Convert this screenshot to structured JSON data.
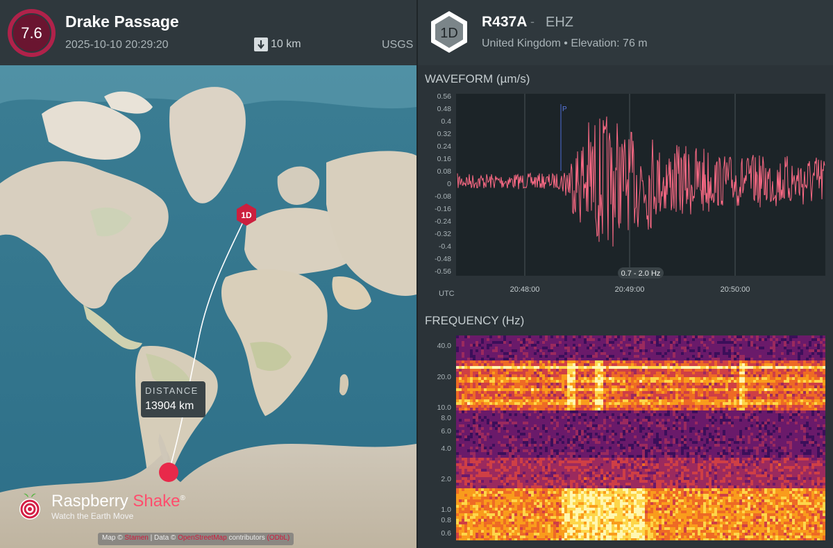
{
  "event": {
    "magnitude": "7.6",
    "title": "Drake Passage",
    "datetime": "2025-10-10 20:29:20",
    "depth": "10 km",
    "source": "USGS",
    "magnitude_color": "#b0224a"
  },
  "map": {
    "station_marker": "1D",
    "distance_label": "DISTANCE",
    "distance_value": "13904 km",
    "epicenter_color": "#e8294a",
    "logo_name_1": "Raspberry",
    "logo_name_2": "Shake",
    "logo_mark": "®",
    "logo_tagline": "Watch the Earth Move",
    "attribution_prefix": "Map ©",
    "attribution_link1": "Stamen",
    "attribution_middle": "| Data ©",
    "attribution_link2": "OpenStreetMap",
    "attribution_suffix": "contributors",
    "attribution_link3": "(ODbL)"
  },
  "station": {
    "badge": "1D",
    "name": "R437A",
    "separator": "-",
    "channel": "EHZ",
    "location": "United Kingdom • Elevation: 76 m"
  },
  "waveform": {
    "title": "WAVEFORM  (µm/s)",
    "y_ticks": [
      "0.56",
      "0.48",
      "0.4",
      "0.32",
      "0.24",
      "0.16",
      "0.08",
      "0",
      "-0.08",
      "-0.16",
      "-0.24",
      "-0.32",
      "-0.4",
      "-0.48",
      "-0.56"
    ],
    "x_ticks": [
      "20:48:00",
      "20:49:00",
      "20:50:00"
    ],
    "x_axis_label": "UTC",
    "phase_label": "P",
    "filter_label": "0.7 - 2.0 Hz",
    "trace_color": "#ff6b86"
  },
  "frequency": {
    "title": "FREQUENCY  (Hz)",
    "y_ticks": [
      "40.0",
      "20.0",
      "10.0",
      "8.0",
      "6.0",
      "4.0",
      "2.0",
      "1.0",
      "0.8",
      "0.6"
    ]
  }
}
